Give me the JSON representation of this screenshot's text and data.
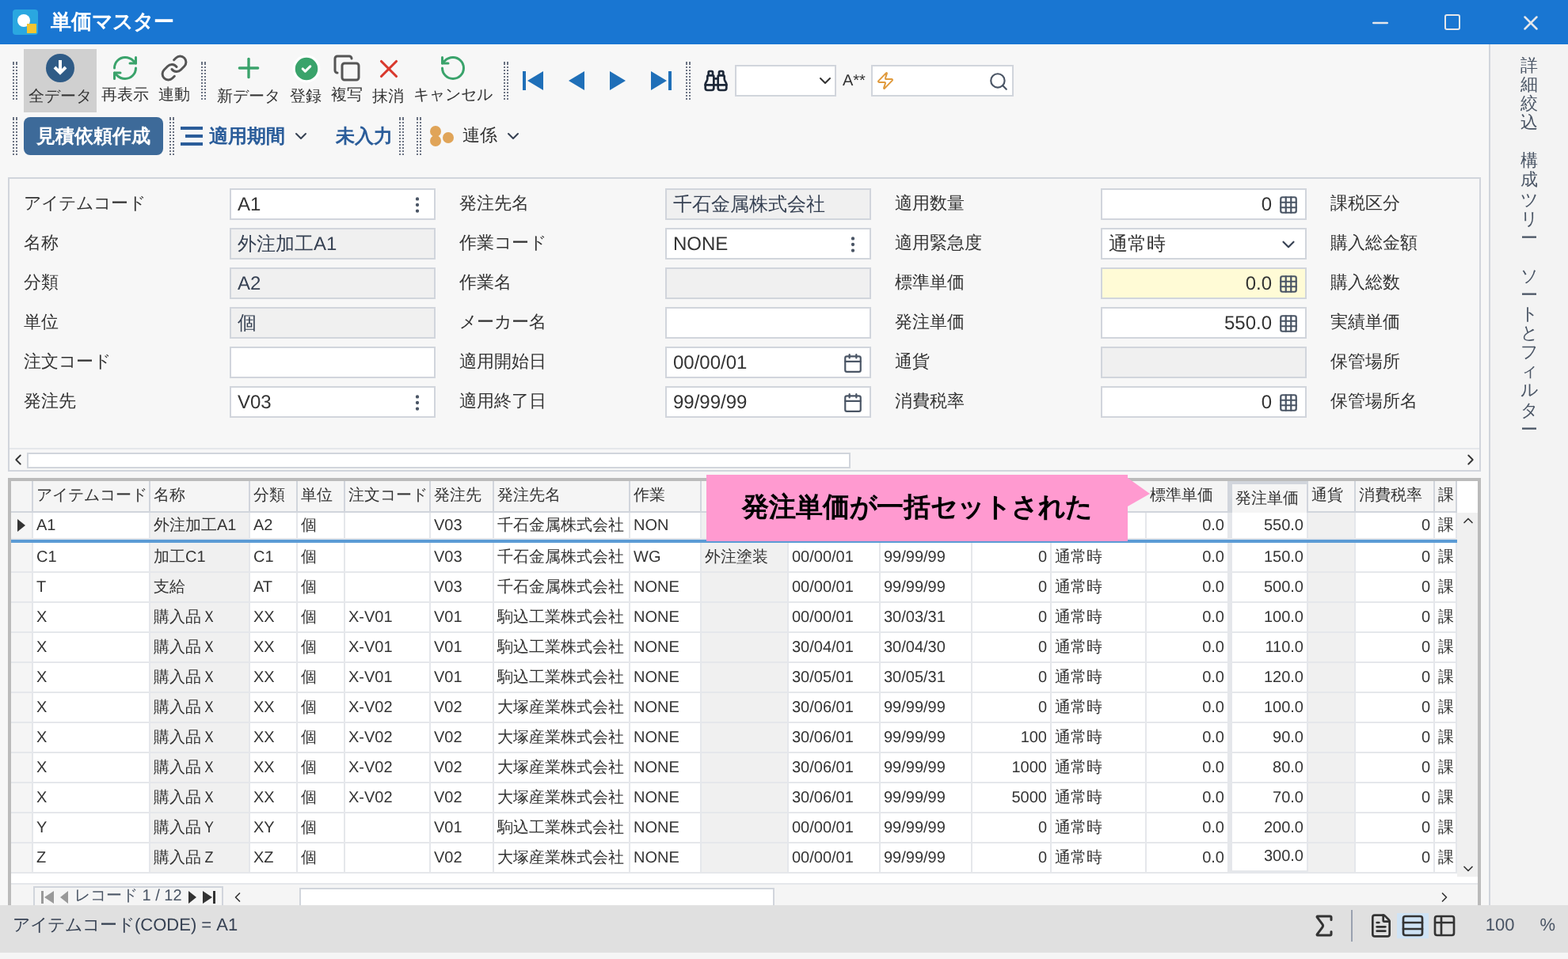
{
  "window": {
    "title": "単価マスター"
  },
  "toolbar": {
    "groups": [
      [
        {
          "label": "全データ",
          "selected": true
        },
        {
          "label": "再表示",
          "selected": false
        },
        {
          "label": "連動",
          "selected": false
        }
      ],
      [
        {
          "label": "新データ",
          "selected": false
        },
        {
          "label": "登録",
          "selected": false
        },
        {
          "label": "複写",
          "selected": false
        },
        {
          "label": "抹消",
          "selected": false
        },
        {
          "label": "キャンセル",
          "selected": false
        }
      ]
    ],
    "font_label": "A**",
    "row2": {
      "primary": "見積依頼作成",
      "period": "適用期間",
      "missing": "未入力",
      "link": "連係"
    }
  },
  "side_tabs": [
    "詳細絞込",
    "構成ツリー",
    "ソートとフィルター"
  ],
  "form": {
    "columns": [
      [
        {
          "label": "アイテムコード",
          "kind": "menu",
          "value": "A1"
        },
        {
          "label": "名称",
          "kind": "readonly",
          "value": "外注加工A1"
        },
        {
          "label": "分類",
          "kind": "readonly",
          "value": "A2"
        },
        {
          "label": "単位",
          "kind": "readonly",
          "value": "個"
        },
        {
          "label": "注文コード",
          "kind": "text"
        },
        {
          "label": "発注先",
          "kind": "menu",
          "value": "V03"
        }
      ],
      [
        {
          "label": "発注先名",
          "kind": "readonly",
          "value": "千石金属株式会社"
        },
        {
          "label": "作業コード",
          "kind": "menu",
          "value": "NONE"
        },
        {
          "label": "作業名",
          "kind": "readonly"
        },
        {
          "label": "メーカー名",
          "kind": "text"
        },
        {
          "label": "適用開始日",
          "kind": "date",
          "value": "00/00/01"
        },
        {
          "label": "適用終了日",
          "kind": "date",
          "value": "99/99/99"
        }
      ],
      [
        {
          "label": "適用数量",
          "kind": "number",
          "value": "0"
        },
        {
          "label": "適用緊急度",
          "kind": "select",
          "value": "通常時"
        },
        {
          "label": "標準単価",
          "kind": "number",
          "value": "0.0",
          "highlighted": true
        },
        {
          "label": "発注単価",
          "kind": "number",
          "value": "550.0"
        },
        {
          "label": "通貨",
          "kind": "readonly"
        },
        {
          "label": "消費税率",
          "kind": "number",
          "value": "0"
        }
      ],
      [
        {
          "label": "課税区分",
          "kind": "label"
        },
        {
          "label": "購入総金額",
          "kind": "label"
        },
        {
          "label": "購入総数",
          "kind": "label"
        },
        {
          "label": "実績単価",
          "kind": "label"
        },
        {
          "label": "保管場所",
          "kind": "label"
        },
        {
          "label": "保管場所名",
          "kind": "label"
        }
      ]
    ]
  },
  "table": {
    "columns": [
      {
        "label": "アイテムコード"
      },
      {
        "label": "名称",
        "readonly": true
      },
      {
        "label": "分類"
      },
      {
        "label": "単位"
      },
      {
        "label": "注文コード"
      },
      {
        "label": "発注先"
      },
      {
        "label": "発注先名"
      },
      {
        "label": "作業"
      },
      {
        "kind": "hidden",
        "readonly": true
      },
      {
        "kind": "hidden"
      },
      {
        "kind": "hidden"
      },
      {
        "kind": "hidden"
      },
      {
        "kind": "hidden"
      },
      {
        "label": "標準単価"
      },
      {
        "label": "発注単価",
        "highlighted": true
      },
      {
        "label": "通貨",
        "readonly": true
      },
      {
        "label": "消費税率"
      },
      {
        "label": "課"
      }
    ],
    "rows": [
      {
        "selected": true,
        "cells": [
          "A1",
          "外注加工A1",
          "A2",
          "個",
          null,
          "V03",
          "千石金属株式会社",
          "NON",
          null,
          null,
          null,
          null,
          null,
          "0.0",
          "550.0",
          null,
          "0",
          "課"
        ]
      },
      {
        "selected": false,
        "cells": [
          "C1",
          "加工C1",
          "C1",
          "個",
          null,
          "V03",
          "千石金属株式会社",
          "WG",
          "外注塗装",
          "00/00/01",
          "99/99/99",
          "0",
          "通常時",
          "0.0",
          "150.0",
          null,
          "0",
          "課"
        ]
      },
      {
        "selected": false,
        "cells": [
          "T",
          "支給",
          "AT",
          "個",
          null,
          "V03",
          "千石金属株式会社",
          "NONE",
          null,
          "00/00/01",
          "99/99/99",
          "0",
          "通常時",
          "0.0",
          "500.0",
          null,
          "0",
          "課"
        ]
      },
      {
        "selected": false,
        "cells": [
          "X",
          "購入品Ｘ",
          "XX",
          "個",
          "X-V01",
          "V01",
          "駒込工業株式会社",
          "NONE",
          null,
          "00/00/01",
          "30/03/31",
          "0",
          "通常時",
          "0.0",
          "100.0",
          null,
          "0",
          "課"
        ]
      },
      {
        "selected": false,
        "cells": [
          "X",
          "購入品Ｘ",
          "XX",
          "個",
          "X-V01",
          "V01",
          "駒込工業株式会社",
          "NONE",
          null,
          "30/04/01",
          "30/04/30",
          "0",
          "通常時",
          "0.0",
          "110.0",
          null,
          "0",
          "課"
        ]
      },
      {
        "selected": false,
        "cells": [
          "X",
          "購入品Ｘ",
          "XX",
          "個",
          "X-V01",
          "V01",
          "駒込工業株式会社",
          "NONE",
          null,
          "30/05/01",
          "30/05/31",
          "0",
          "通常時",
          "0.0",
          "120.0",
          null,
          "0",
          "課"
        ]
      },
      {
        "selected": false,
        "cells": [
          "X",
          "購入品Ｘ",
          "XX",
          "個",
          "X-V02",
          "V02",
          "大塚産業株式会社",
          "NONE",
          null,
          "30/06/01",
          "99/99/99",
          "0",
          "通常時",
          "0.0",
          "100.0",
          null,
          "0",
          "課"
        ]
      },
      {
        "selected": false,
        "cells": [
          "X",
          "購入品Ｘ",
          "XX",
          "個",
          "X-V02",
          "V02",
          "大塚産業株式会社",
          "NONE",
          null,
          "30/06/01",
          "99/99/99",
          "100",
          "通常時",
          "0.0",
          "90.0",
          null,
          "0",
          "課"
        ]
      },
      {
        "selected": false,
        "cells": [
          "X",
          "購入品Ｘ",
          "XX",
          "個",
          "X-V02",
          "V02",
          "大塚産業株式会社",
          "NONE",
          null,
          "30/06/01",
          "99/99/99",
          "1000",
          "通常時",
          "0.0",
          "80.0",
          null,
          "0",
          "課"
        ]
      },
      {
        "selected": false,
        "cells": [
          "X",
          "購入品Ｘ",
          "XX",
          "個",
          "X-V02",
          "V02",
          "大塚産業株式会社",
          "NONE",
          null,
          "30/06/01",
          "99/99/99",
          "5000",
          "通常時",
          "0.0",
          "70.0",
          null,
          "0",
          "課"
        ]
      },
      {
        "selected": false,
        "cells": [
          "Y",
          "購入品Ｙ",
          "XY",
          "個",
          null,
          "V01",
          "駒込工業株式会社",
          "NONE",
          null,
          "00/00/01",
          "99/99/99",
          "0",
          "通常時",
          "0.0",
          "200.0",
          null,
          "0",
          "課"
        ]
      },
      {
        "selected": false,
        "cells": [
          "Z",
          "購入品Ｚ",
          "XZ",
          "個",
          null,
          "V02",
          "大塚産業株式会社",
          "NONE",
          null,
          "00/00/01",
          "99/99/99",
          "0",
          "通常時",
          "0.0",
          "300.0",
          null,
          "0",
          "課"
        ]
      }
    ],
    "record_label": "レコード 1 / 12"
  },
  "callout": "発注単価が一括セットされた",
  "status_bar": {
    "text": "アイテムコード(CODE) = A1",
    "views": [
      {
        "selected": false
      },
      {
        "selected": true
      },
      {
        "selected": false
      }
    ],
    "zoom": "100",
    "unit": "%"
  }
}
